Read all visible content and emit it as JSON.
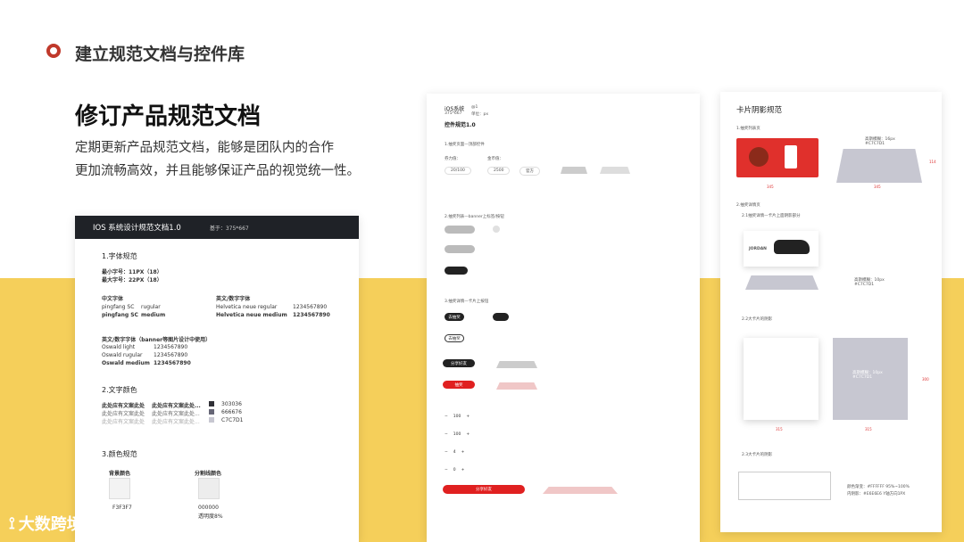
{
  "header": {
    "title": "建立规范文档与控件库"
  },
  "main": {
    "title": "修订产品规范文档",
    "desc_line1": "定期更新产品规范文档，能够是团队内的合作",
    "desc_line2": "更加流畅高效，并且能够保证产品的视觉统一性。"
  },
  "doc_card": {
    "title": "IOS 系统设计规范文档1.0",
    "subtitle": "基于：375*667",
    "s1": "1.字体规范",
    "min_font": "最小字号：11PX（18）",
    "max_font": "最大字号：22PX（18）",
    "cn_font_label": "中文字体",
    "cn_f1_name": "pingfang SC",
    "cn_f1_weight": "rugular",
    "cn_f2_name": "pingfang SC",
    "cn_f2_weight": "medium",
    "en_font_label": "英文/数字字体",
    "en_f1_name": "Helvetica neue regular",
    "en_f1_num": "1234567890",
    "en_f2_name": "Helvetica neue medium",
    "en_f2_num": "1234567890",
    "oswald_label": "英文/数字字体（banner等图片设计中使用）",
    "osw1": "Oswald light",
    "osw1_num": "1234567890",
    "osw2": "Oswald rugular",
    "osw2_num": "1234567890",
    "osw3": "Oswald medium",
    "osw3_num": "1234567890",
    "s2": "2.文字颜色",
    "tc1a": "此处应有文案此处",
    "tc1b": "此处应有文案此处...",
    "tc1c": "303036",
    "tc2a": "此处应有文案此处",
    "tc2b": "此处应有文案此处...",
    "tc2c": "666676",
    "tc3a": "此处应有文案此处",
    "tc3b": "此处应有文案此处...",
    "tc3c": "C7C7D1",
    "s3": "3.颜色规范",
    "bg_label": "背景颜色",
    "bg_code": "F3F3F7",
    "div_label": "分割线颜色",
    "div_code": "000000",
    "div_opacity": "透明度8%"
  },
  "mid_card": {
    "title": "iOS系统",
    "version": "@1",
    "size": "375*667",
    "unit": "单位：px",
    "subtitle": "控件规范1.0",
    "s1": "1.抽奖页面—顶部控件",
    "lbl_points": "券力值：",
    "lbl_gold": "金币值：",
    "val_points": "20/100",
    "val_gold": "2500",
    "val_rule": "官方",
    "s2": "2.抽奖列表—banner上标签/按钮",
    "s3": "3.抽奖详情—卡片上按钮",
    "share": "分享好友",
    "draw": "抽奖",
    "go_draw": "去抽奖",
    "step1": "100",
    "step2": "100",
    "step3": "4",
    "step4": "0",
    "bottom_btn": "分享好友"
  },
  "right_card": {
    "title": "卡片阴影规范",
    "s1": "1.抽奖列表页",
    "shadow1": "高斯模糊：16px",
    "shadow1_color": "#C7C7D1",
    "dim1a": "345",
    "dim1b": "345",
    "dim1c": "114",
    "s2": "2.抽奖详情页",
    "s2sub": "2.1抽奖详情—卡片上面阴影部分",
    "product": "JORDAN",
    "shadow2": "高斯模糊：10px",
    "shadow2_color": "#C7C7D1",
    "s22": "2.2大卡片的阴影",
    "shadow3": "高斯模糊：10px",
    "shadow3_color": "#C7C7D1",
    "dim3": "300",
    "dim3a": "315",
    "dim3b": "315",
    "s23": "2.3大卡片的阴影",
    "color_label": "颜色渐变：#FFFFFF  95%~100%",
    "shadow4": "内阴影：#E6E6E6  Y轴方向1PX"
  },
  "logo": {
    "text": "大数跨境"
  }
}
